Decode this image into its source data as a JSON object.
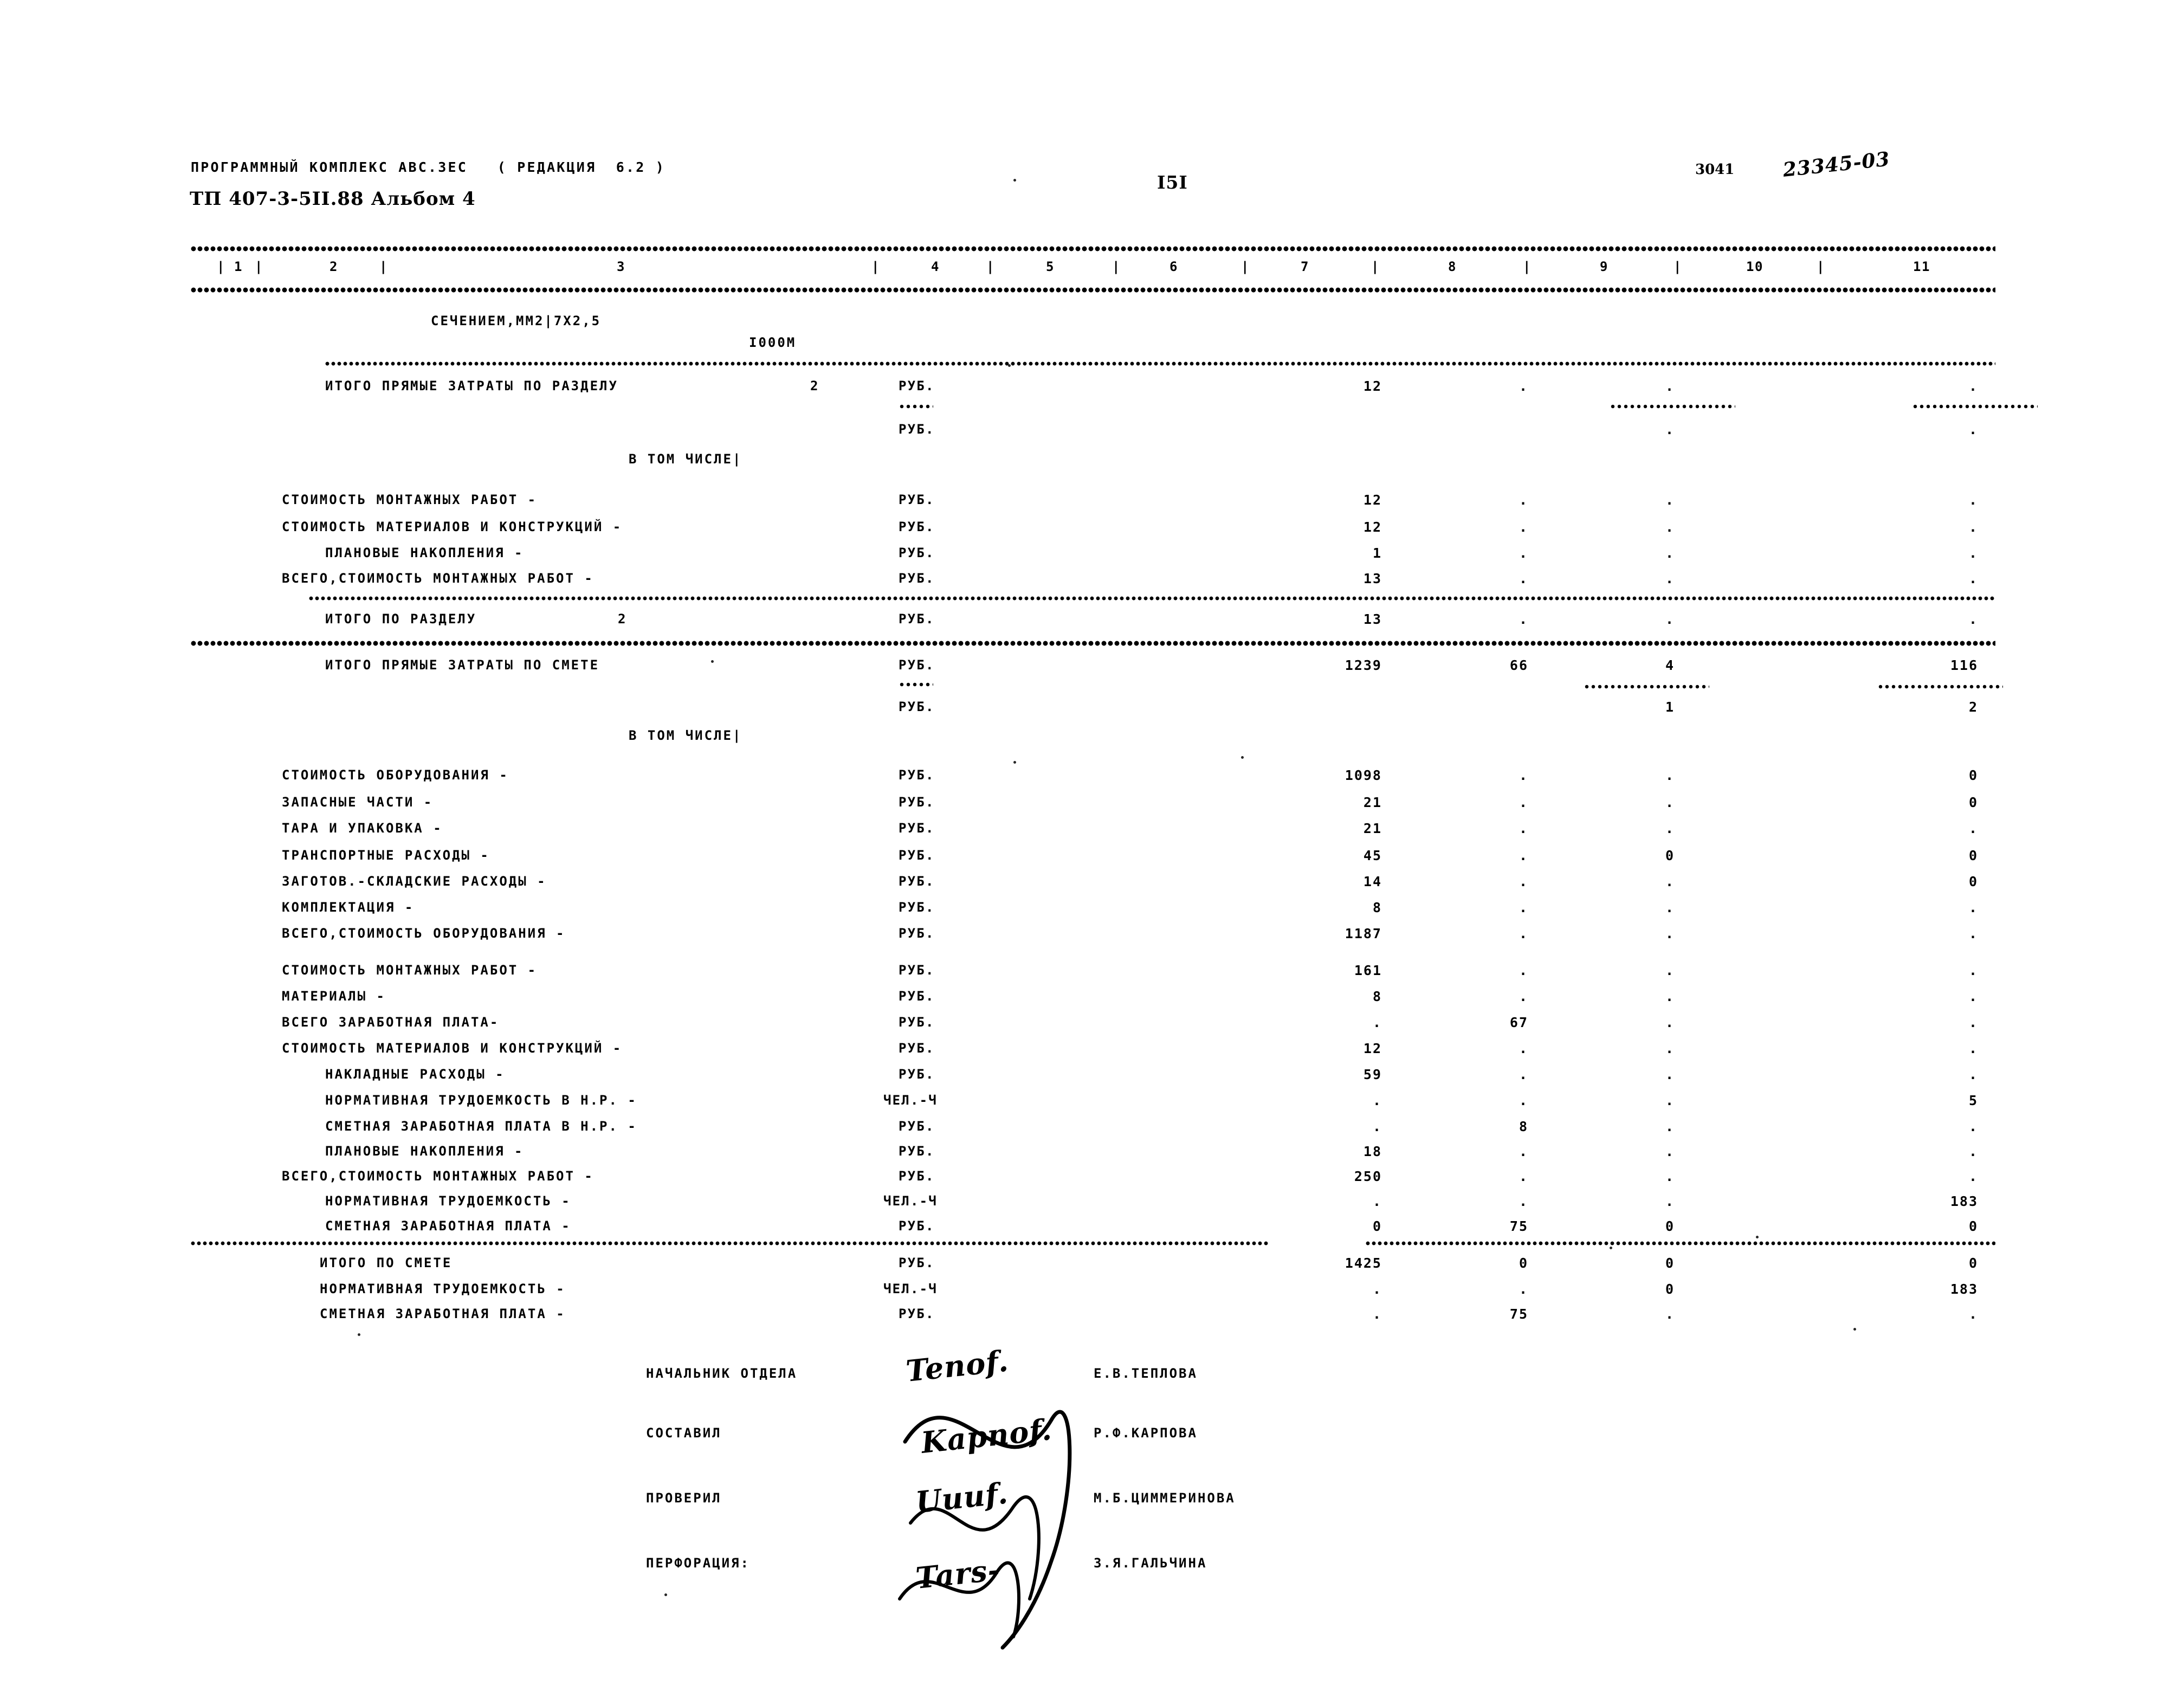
{
  "header": {
    "program_line": "ПРОГРАММНЫЙ КОМПЛЕКС АВС.ЗЕС   ( РЕДАКЦИЯ  6.2 )",
    "document_code": "ТП 407-3-5II.88 Альбом 4",
    "page_number": "I5I",
    "stamp_number": "3041",
    "order_code": "23345-03"
  },
  "columns": {
    "numbers": [
      "1",
      "2",
      "3",
      "4",
      "5",
      "6",
      "7",
      "8",
      "9",
      "10",
      "11"
    ]
  },
  "section": {
    "spec_line": "СЕЧЕНИЕМ,ММ2|7Х2,5",
    "quantity_line": "I000М",
    "subtotal_label": "ИТОГО ПРЯМЫЕ ЗАТРАТЫ ПО РАЗДЕЛУ",
    "subtotal_section_no": "2",
    "in_that_number": "В ТОМ ЧИСЛЕ|",
    "unit_rub": "РУБ.",
    "unit_chel": "ЧЕЛ.-Ч"
  },
  "section_rows": [
    {
      "label": "СТОИМОСТЬ МОНТАЖНЫХ РАБОТ -",
      "unit": "РУБ.",
      "c1": "12",
      "c2": ".",
      "c3": ".",
      "c4": "."
    },
    {
      "label": "СТОИМОСТЬ МАТЕРИАЛОВ И КОНСТРУКЦИЙ -",
      "unit": "РУБ.",
      "c1": "12",
      "c2": ".",
      "c3": ".",
      "c4": "."
    },
    {
      "label": "ПЛАНОВЫЕ НАКОПЛЕНИЯ -",
      "unit": "РУБ.",
      "c1": "1",
      "c2": ".",
      "c3": ".",
      "c4": "."
    },
    {
      "label": "ВСЕГО,СТОИМОСТЬ МОНТАЖНЫХ РАБОТ -",
      "unit": "РУБ.",
      "c1": "13",
      "c2": ".",
      "c3": ".",
      "c4": "."
    }
  ],
  "section_total": {
    "label": "ИТОГО ПО РАЗДЕЛУ",
    "section_no": "2",
    "unit": "РУБ.",
    "c1": "13",
    "c2": ".",
    "c3": ".",
    "c4": "."
  },
  "estimate_total_header": {
    "label": "ИТОГО ПРЯМЫЕ ЗАТРАТЫ ПО СМЕТЕ",
    "unit": "РУБ.",
    "c1": "1239",
    "c2": "66",
    "c3": "4",
    "c4": "116",
    "second_unit": "РУБ.",
    "s3": "1",
    "s4": "2",
    "in_that_number": "В ТОМ ЧИСЛЕ|"
  },
  "equipment_rows": [
    {
      "label": "СТОИМОСТЬ ОБОРУДОВАНИЯ -",
      "unit": "РУБ.",
      "c1": "1098",
      "c2": ".",
      "c3": ".",
      "c4": "0"
    },
    {
      "label": "ЗАПАСНЫЕ ЧАСТИ -",
      "unit": "РУБ.",
      "c1": "21",
      "c2": ".",
      "c3": ".",
      "c4": "0"
    },
    {
      "label": "ТАРА И УПАКОВКА -",
      "unit": "РУБ.",
      "c1": "21",
      "c2": ".",
      "c3": ".",
      "c4": "."
    },
    {
      "label": "ТРАНСПОРТНЫЕ РАСХОДЫ -",
      "unit": "РУБ.",
      "c1": "45",
      "c2": ".",
      "c3": "0",
      "c4": "0"
    },
    {
      "label": "ЗАГОТОВ.-СКЛАДСКИЕ РАСХОДЫ -",
      "unit": "РУБ.",
      "c1": "14",
      "c2": ".",
      "c3": ".",
      "c4": "0"
    },
    {
      "label": "КОМПЛЕКТАЦИЯ -",
      "unit": "РУБ.",
      "c1": "8",
      "c2": ".",
      "c3": ".",
      "c4": "."
    },
    {
      "label": "ВСЕГО,СТОИМОСТЬ ОБОРУДОВАНИЯ -",
      "unit": "РУБ.",
      "c1": "1187",
      "c2": ".",
      "c3": ".",
      "c4": "."
    }
  ],
  "montage_rows": [
    {
      "label": "СТОИМОСТЬ МОНТАЖНЫХ РАБОТ -",
      "unit": "РУБ.",
      "c1": "161",
      "c2": ".",
      "c3": ".",
      "c4": "."
    },
    {
      "label": "МАТЕРИАЛЫ -",
      "unit": "РУБ.",
      "c1": "8",
      "c2": ".",
      "c3": ".",
      "c4": "."
    },
    {
      "label": "ВСЕГО ЗАРАБОТНАЯ ПЛАТА-",
      "unit": "РУБ.",
      "c1": ".",
      "c2": "67",
      "c3": ".",
      "c4": "."
    },
    {
      "label": "СТОИМОСТЬ МАТЕРИАЛОВ И КОНСТРУКЦИЙ -",
      "unit": "РУБ.",
      "c1": "12",
      "c2": ".",
      "c3": ".",
      "c4": "."
    },
    {
      "label": "НАКЛАДНЫЕ РАСХОДЫ -",
      "unit": "РУБ.",
      "c1": "59",
      "c2": ".",
      "c3": ".",
      "c4": "."
    },
    {
      "label": "НОРМАТИВНАЯ ТРУДОЕМКОСТЬ В Н.Р. -",
      "unit": "ЧЕЛ.-Ч",
      "c1": ".",
      "c2": ".",
      "c3": ".",
      "c4": "5"
    },
    {
      "label": "СМЕТНАЯ ЗАРАБОТНАЯ ПЛАТА В Н.Р. -",
      "unit": "РУБ.",
      "c1": ".",
      "c2": "8",
      "c3": ".",
      "c4": "."
    },
    {
      "label": "ПЛАНОВЫЕ НАКОПЛЕНИЯ -",
      "unit": "РУБ.",
      "c1": "18",
      "c2": ".",
      "c3": ".",
      "c4": "."
    },
    {
      "label": "ВСЕГО,СТОИМОСТЬ МОНТАЖНЫХ РАБОТ -",
      "unit": "РУБ.",
      "c1": "250",
      "c2": ".",
      "c3": ".",
      "c4": "."
    },
    {
      "label": "НОРМАТИВНАЯ ТРУДОЕМКОСТЬ -",
      "unit": "ЧЕЛ.-Ч",
      "c1": ".",
      "c2": ".",
      "c3": ".",
      "c4": "183"
    },
    {
      "label": "СМЕТНАЯ ЗАРАБОТНАЯ ПЛАТА -",
      "unit": "РУБ.",
      "c1": "0",
      "c2": "75",
      "c3": "0",
      "c4": "0"
    }
  ],
  "grand_total_rows": [
    {
      "label": "ИТОГО ПО СМЕТЕ",
      "unit": "РУБ.",
      "c1": "1425",
      "c2": "0",
      "c3": "0",
      "c4": "0"
    },
    {
      "label": "НОРМАТИВНАЯ ТРУДОЕМКОСТЬ -",
      "unit": "ЧЕЛ.-Ч",
      "c1": ".",
      "c2": ".",
      "c3": "0",
      "c4": "183"
    },
    {
      "label": "СМЕТНАЯ ЗАРАБОТНАЯ ПЛАТА -",
      "unit": "РУБ.",
      "c1": ".",
      "c2": "75",
      "c3": ".",
      "c4": "."
    }
  ],
  "signatures": [
    {
      "role": "НАЧАЛЬНИК ОТДЕЛА",
      "signature": "Tenof.",
      "name": "Е.В.ТЕПЛОВА"
    },
    {
      "role": "СОСТАВИЛ",
      "signature": "Kapnof.",
      "name": "Р.Ф.КАРПОВА"
    },
    {
      "role": "ПРОВЕРИЛ",
      "signature": "Uuuf.",
      "name": "М.Б.ЦИММЕРИНОВА"
    },
    {
      "role": "ПЕРФОРАЦИЯ:",
      "signature": "Tars-",
      "name": "З.Я.ГАЛЬЧИНА"
    }
  ]
}
